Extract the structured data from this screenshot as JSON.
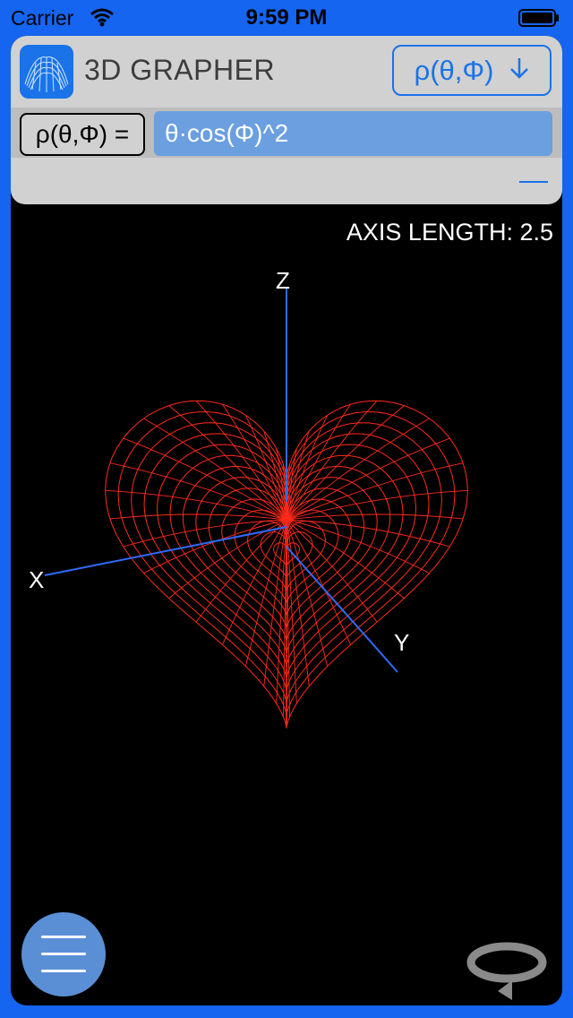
{
  "status_bar": {
    "carrier": "Carrier",
    "time": "9:59 PM"
  },
  "header": {
    "app_icon": "surface-plot-icon",
    "title": "3D GRAPHER",
    "mode_button": {
      "label": "ρ(θ,Φ)",
      "icon": "arrow-down-icon"
    }
  },
  "equation": {
    "label": "ρ(θ,Φ) =",
    "value": "θ·cos(Φ)^2"
  },
  "graph": {
    "axis_length_label": "AXIS LENGTH: 2.5",
    "axes": {
      "x": "X",
      "y": "Y",
      "z": "Z"
    },
    "surface_color": "#ff2a1a",
    "axis_color": "#2f6bff"
  },
  "controls": {
    "menu_icon": "hamburger-menu-icon",
    "rotate_icon": "rotate-icon"
  },
  "colors": {
    "accent": "#1565f0",
    "input_bg": "#6b9fe0",
    "panel_bg": "#d1d1d1"
  }
}
